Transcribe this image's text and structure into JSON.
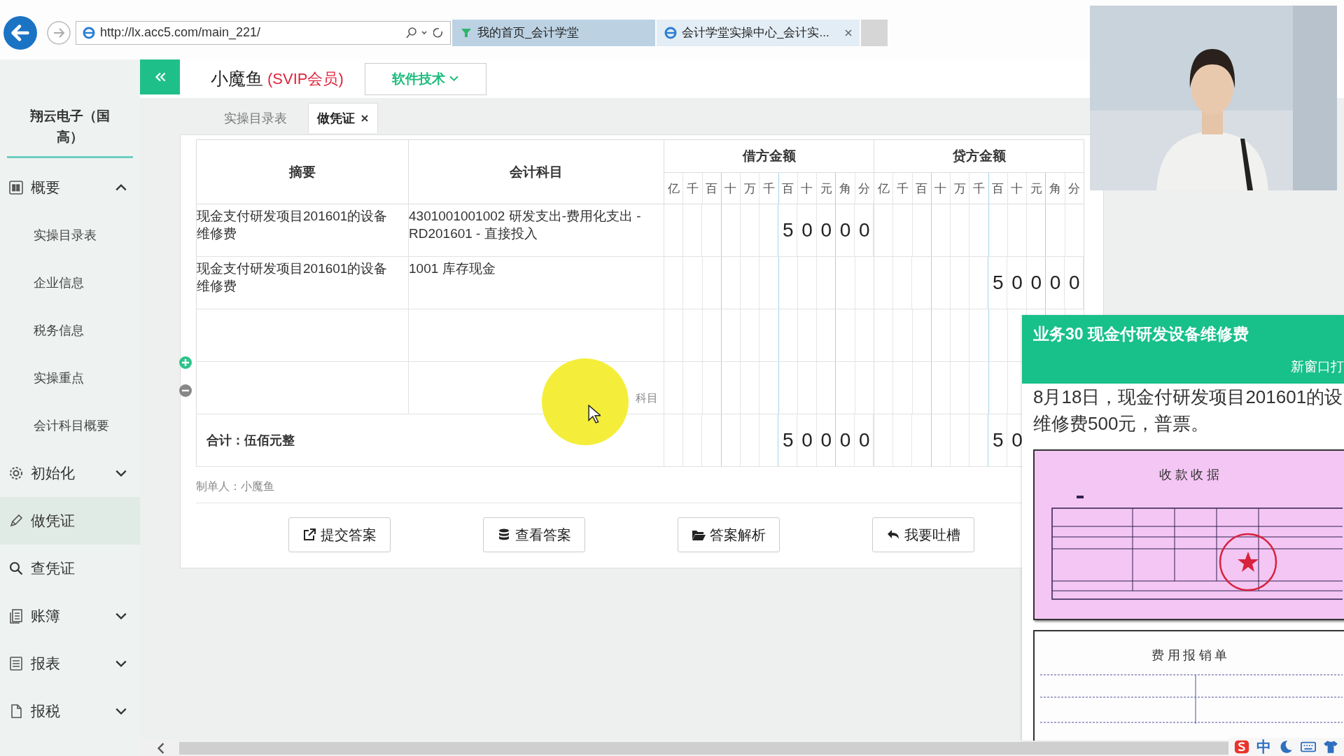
{
  "browser": {
    "address": "http://lx.acc5.com/main_221/",
    "tabs": [
      {
        "title": "我的首页_会计学堂",
        "selected": false,
        "closable": false
      },
      {
        "title": "会计学堂实操中心_会计实...",
        "selected": true,
        "closable": true
      }
    ]
  },
  "sidebar": {
    "company": "翔云电子（国高）",
    "items": [
      {
        "label": "概要",
        "kind": "group",
        "expanded": true,
        "selected": false,
        "children": [
          {
            "label": "实操目录表",
            "selected": false
          },
          {
            "label": "企业信息",
            "selected": false
          },
          {
            "label": "税务信息",
            "selected": false
          },
          {
            "label": "实操重点",
            "selected": false
          },
          {
            "label": "会计科目概要",
            "selected": false
          }
        ]
      },
      {
        "label": "初始化",
        "kind": "group",
        "expanded": false,
        "selected": false
      },
      {
        "label": "做凭证",
        "kind": "link",
        "selected": true
      },
      {
        "label": "查凭证",
        "kind": "link",
        "selected": false
      },
      {
        "label": "账簿",
        "kind": "group",
        "expanded": false,
        "selected": false
      },
      {
        "label": "报表",
        "kind": "group",
        "expanded": false,
        "selected": false
      },
      {
        "label": "报税",
        "kind": "group",
        "expanded": false,
        "selected": false
      }
    ]
  },
  "header": {
    "user": "小魔鱼",
    "membership": "(SVIP会员)",
    "dropdown": "软件技术"
  },
  "page_tabs": [
    {
      "label": "实操目录表",
      "selected": false,
      "closable": false
    },
    {
      "label": "做凭证",
      "selected": true,
      "closable": true
    }
  ],
  "voucher": {
    "columns": [
      "摘要",
      "会计科目"
    ],
    "debit_label": "借方金额",
    "credit_label": "贷方金额",
    "debit_units": [
      "亿",
      "千",
      "百",
      "十",
      "万",
      "千",
      "百",
      "十",
      "元",
      "角",
      "分"
    ],
    "credit_units": [
      "亿",
      "千",
      "百",
      "十",
      "万",
      "千",
      "百",
      "十",
      "元",
      "角",
      "分"
    ],
    "rows": [
      {
        "summary": "现金支付研发项目201601的设备维修费",
        "account": "4301001001002 研发支出-费用化支出 - RD201601 - 直接投入",
        "debit": "50000"
      },
      {
        "summary": "现金支付研发项目201601的设备维修费",
        "account": "1001 库存现金",
        "credit": "50000"
      },
      {},
      {
        "account_placeholder": "科目"
      }
    ],
    "total": {
      "label": "合计：伍佰元整",
      "debit": "50000",
      "credit": "50"
    },
    "maker": "制单人：小魔鱼"
  },
  "buttons": [
    {
      "label": "提交答案"
    },
    {
      "label": "查看答案"
    },
    {
      "label": "答案解析"
    },
    {
      "label": "我要吐槽"
    }
  ],
  "task_panel": {
    "title": "业务30 现金付研发设备维修费",
    "open_link": "新窗口打",
    "description": [
      "8月18日，现金付研发项目201601的设",
      "维修费500元，普票。"
    ],
    "attachments": [
      {
        "kind": "receipt",
        "title": "收 款 收 据"
      },
      {
        "kind": "expense_form",
        "title": "费 用 报 销 单"
      }
    ]
  },
  "ime": {
    "mode": "中"
  }
}
